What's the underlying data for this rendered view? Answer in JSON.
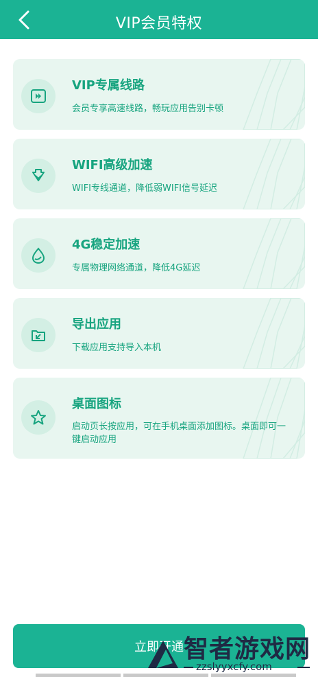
{
  "header": {
    "title": "VIP会员特权"
  },
  "cards": [
    {
      "title": "VIP专属线路",
      "desc": "会员专享高速线路，畅玩应用告别卡顿",
      "icon": "fast-forward-icon"
    },
    {
      "title": "WIFI高级加速",
      "desc": "WIFI专线通道，降低弱WIFI信号延迟",
      "icon": "download-shield-icon"
    },
    {
      "title": "4G稳定加速",
      "desc": "专属物理网络通道，降低4G延迟",
      "icon": "drop-icon"
    },
    {
      "title": "导出应用",
      "desc": "下载应用支持导入本机",
      "icon": "export-folder-icon"
    },
    {
      "title": "桌面图标",
      "desc": "启动页长按应用，可在手机桌面添加图标。桌面即可一键启动应用",
      "icon": "star-icon"
    }
  ],
  "cta": {
    "label": "立即开通"
  },
  "watermark": {
    "text": "智者游戏网",
    "url": "zzslyyxcfy.com"
  },
  "colors": {
    "accent": "#1bb394",
    "card_bg": "#e8f6f0",
    "text_green": "#17a47f"
  }
}
